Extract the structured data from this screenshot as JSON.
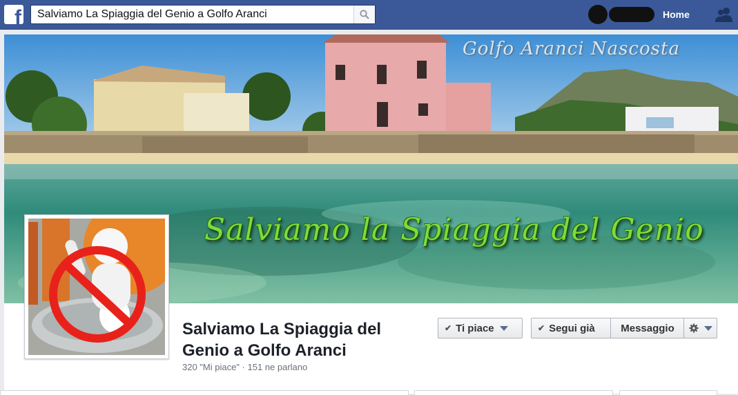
{
  "topbar": {
    "search_value": "Salviamo La Spiaggia del Genio a Golfo Aranci",
    "home_label": "Home",
    "brand_color": "#3b5998",
    "logo_icon": "facebook-f-icon",
    "search_icon": "search-icon",
    "friends_icon": "friend-requests-icon"
  },
  "cover": {
    "watermark": "Golfo Aranci Nascosta",
    "title": "Salviamo la Spiaggia del Genio"
  },
  "page": {
    "name": "Salviamo La Spiaggia del Genio a Golfo Aranci",
    "stats": "320 \"Mi piace\" · 151 ne parlano"
  },
  "actions": {
    "like_label": "Ti piace",
    "follow_label": "Segui già",
    "message_label": "Messaggio",
    "settings_icon": "gear-icon"
  }
}
